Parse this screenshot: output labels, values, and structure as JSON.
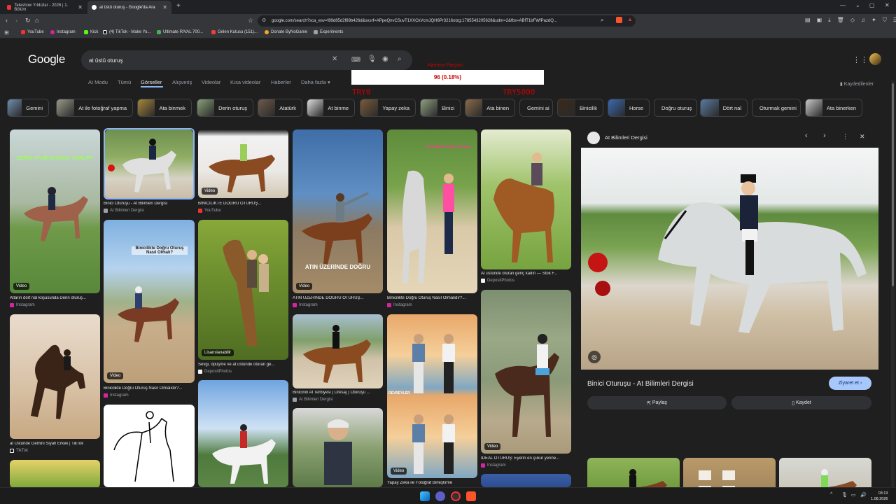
{
  "browser": {
    "tabs": [
      {
        "title": "Teleshow Yıldızlar - 2026 | 1. Bölüm"
      },
      {
        "title": "at üstü oturuş - Google'da Ara"
      }
    ],
    "url": "google.com/search?sca_esv=f89d85d2f89b426d&sxsrf=APpeQnvCSuvT1XXCkVcmJQH6Pr3216otzg:1785543205628&udm=2&fbs=ABfT1bFWfPazdQ...",
    "bookmarks": [
      "YouTube",
      "Instagram",
      "Kick",
      "(4) TikTok - Make Yo...",
      "Ultimate RIVAL 700...",
      "Gelen Kutusu (151)...",
      "Donate ByNoGame",
      "Experiments"
    ]
  },
  "google": {
    "logo": "Google",
    "query": "at üstü oturuş",
    "nav": [
      "AI Modu",
      "Tümü",
      "Görseller",
      "Alışveriş",
      "Videolar",
      "Kısa videolar",
      "Haberler",
      "Daha fazla ▾"
    ],
    "saved": "Kaydedilenler",
    "chips": [
      "Gemini",
      "At ile fotoğraf yapma",
      "Ata binmek",
      "Derin oturuş",
      "Atatürk",
      "At binme",
      "Yapay zeka",
      "Binici",
      "Ata binen",
      "Gemini ai",
      "Binicilik",
      "Horse",
      "Doğru oturuş",
      "Dört nal",
      "Oturmak gemini",
      "Ata binerken"
    ]
  },
  "overlay": {
    "label": "Kamera Parçası",
    "value": "96 (0.18%)",
    "left": "TRY0",
    "right": "TRY5000"
  },
  "results": [
    {
      "caption": "Atların dört nal koşusunda Derin oturuş...",
      "source": "Instagram",
      "badge": "Video",
      "overlay": "DERİN OTURUŞ NASIL YAPILIR?"
    },
    {
      "caption": "at Üstünde Gemini Siyah Erkek | TikTok",
      "source": "TikTok"
    },
    {
      "caption": "Binici Oturuşu - At Bilimleri Dergisi",
      "source": "At Bilimleri Dergisi"
    },
    {
      "caption": "Binicilikte Doğru Oturuş Nasıl Olmalıdır?...",
      "source": "Instagram",
      "badge": "Video",
      "overlay": "Binicilikte Doğru Oturuş Nasıl Olmalı?"
    },
    {
      "caption": "BİNİCİLİKTE DOĞRU OTURUŞ...",
      "source": "YouTube",
      "badge": "Video"
    },
    {
      "caption": "Sevgi, öpüşme ve at üstünde oturan ge...",
      "source": "DepositPhotos",
      "badge": "Lisanslanabilir"
    },
    {
      "caption": "ATIN ÜZERİNDE DOĞRU OTURUŞ...",
      "source": "Instagram",
      "badge": "Video",
      "overlay": "ATIN ÜZERİNDE DOĞRU"
    },
    {
      "caption": "Binicinin At Terbiyesi ( Dresaj ) Oturuşu ...",
      "source": "At Bilimleri Dergisi"
    },
    {
      "caption": "Binicilikte Doğru Oturuş Nasıl Olmalıdır?...",
      "source": "Instagram"
    },
    {
      "caption": "Yapay Zeka ile Fotoğraf Birleştirme",
      "source": "",
      "badge": "Video",
      "overlay": "DEVREYLER"
    },
    {
      "caption": "At üstünde oturan genç kadın — Stok F...",
      "source": "DepositPhotos"
    },
    {
      "caption": "İDEAL OTURUŞ: Eyerin en çukur yerine...",
      "source": "Instagram",
      "badge": "Video"
    }
  ],
  "panel": {
    "site": "At Bilimleri Dergisi",
    "title": "Binici Oturuşu - At Bilimleri Dergisi",
    "visit": "Ziyaret et ›",
    "share": "Paylaş",
    "save": "Kaydet"
  },
  "taskbar": {
    "time": "03:13",
    "date": "1.08.2026"
  },
  "colors": {
    "accent": "#8ab4f8",
    "visit_bg": "#a8c7fa",
    "overlay_text": "#cc0000"
  }
}
